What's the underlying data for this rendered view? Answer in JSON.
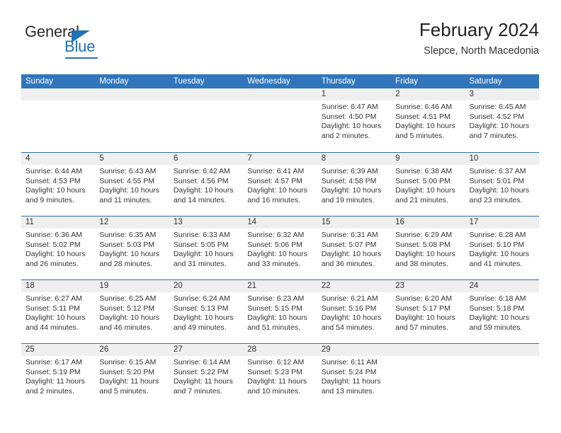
{
  "brand": {
    "name_part1": "General",
    "name_part2": "Blue",
    "triangle_color": "#2171b5"
  },
  "header": {
    "title": "February 2024",
    "subtitle": "Slepce, North Macedonia"
  },
  "theme": {
    "header_blue": "#3176bc",
    "separator_blue": "#2f6fad",
    "datebar_gray": "#efefef"
  },
  "weekdays": [
    "Sunday",
    "Monday",
    "Tuesday",
    "Wednesday",
    "Thursday",
    "Friday",
    "Saturday"
  ],
  "weeks": [
    {
      "days": [
        {
          "num": "",
          "lines": []
        },
        {
          "num": "",
          "lines": []
        },
        {
          "num": "",
          "lines": []
        },
        {
          "num": "",
          "lines": []
        },
        {
          "num": "1",
          "lines": [
            "Sunrise: 6:47 AM",
            "Sunset: 4:50 PM",
            "Daylight: 10 hours",
            "and 2 minutes."
          ]
        },
        {
          "num": "2",
          "lines": [
            "Sunrise: 6:46 AM",
            "Sunset: 4:51 PM",
            "Daylight: 10 hours",
            "and 5 minutes."
          ]
        },
        {
          "num": "3",
          "lines": [
            "Sunrise: 6:45 AM",
            "Sunset: 4:52 PM",
            "Daylight: 10 hours",
            "and 7 minutes."
          ]
        }
      ]
    },
    {
      "days": [
        {
          "num": "4",
          "lines": [
            "Sunrise: 6:44 AM",
            "Sunset: 4:53 PM",
            "Daylight: 10 hours",
            "and 9 minutes."
          ]
        },
        {
          "num": "5",
          "lines": [
            "Sunrise: 6:43 AM",
            "Sunset: 4:55 PM",
            "Daylight: 10 hours",
            "and 11 minutes."
          ]
        },
        {
          "num": "6",
          "lines": [
            "Sunrise: 6:42 AM",
            "Sunset: 4:56 PM",
            "Daylight: 10 hours",
            "and 14 minutes."
          ]
        },
        {
          "num": "7",
          "lines": [
            "Sunrise: 6:41 AM",
            "Sunset: 4:57 PM",
            "Daylight: 10 hours",
            "and 16 minutes."
          ]
        },
        {
          "num": "8",
          "lines": [
            "Sunrise: 6:39 AM",
            "Sunset: 4:58 PM",
            "Daylight: 10 hours",
            "and 19 minutes."
          ]
        },
        {
          "num": "9",
          "lines": [
            "Sunrise: 6:38 AM",
            "Sunset: 5:00 PM",
            "Daylight: 10 hours",
            "and 21 minutes."
          ]
        },
        {
          "num": "10",
          "lines": [
            "Sunrise: 6:37 AM",
            "Sunset: 5:01 PM",
            "Daylight: 10 hours",
            "and 23 minutes."
          ]
        }
      ]
    },
    {
      "days": [
        {
          "num": "11",
          "lines": [
            "Sunrise: 6:36 AM",
            "Sunset: 5:02 PM",
            "Daylight: 10 hours",
            "and 26 minutes."
          ]
        },
        {
          "num": "12",
          "lines": [
            "Sunrise: 6:35 AM",
            "Sunset: 5:03 PM",
            "Daylight: 10 hours",
            "and 28 minutes."
          ]
        },
        {
          "num": "13",
          "lines": [
            "Sunrise: 6:33 AM",
            "Sunset: 5:05 PM",
            "Daylight: 10 hours",
            "and 31 minutes."
          ]
        },
        {
          "num": "14",
          "lines": [
            "Sunrise: 6:32 AM",
            "Sunset: 5:06 PM",
            "Daylight: 10 hours",
            "and 33 minutes."
          ]
        },
        {
          "num": "15",
          "lines": [
            "Sunrise: 6:31 AM",
            "Sunset: 5:07 PM",
            "Daylight: 10 hours",
            "and 36 minutes."
          ]
        },
        {
          "num": "16",
          "lines": [
            "Sunrise: 6:29 AM",
            "Sunset: 5:08 PM",
            "Daylight: 10 hours",
            "and 38 minutes."
          ]
        },
        {
          "num": "17",
          "lines": [
            "Sunrise: 6:28 AM",
            "Sunset: 5:10 PM",
            "Daylight: 10 hours",
            "and 41 minutes."
          ]
        }
      ]
    },
    {
      "days": [
        {
          "num": "18",
          "lines": [
            "Sunrise: 6:27 AM",
            "Sunset: 5:11 PM",
            "Daylight: 10 hours",
            "and 44 minutes."
          ]
        },
        {
          "num": "19",
          "lines": [
            "Sunrise: 6:25 AM",
            "Sunset: 5:12 PM",
            "Daylight: 10 hours",
            "and 46 minutes."
          ]
        },
        {
          "num": "20",
          "lines": [
            "Sunrise: 6:24 AM",
            "Sunset: 5:13 PM",
            "Daylight: 10 hours",
            "and 49 minutes."
          ]
        },
        {
          "num": "21",
          "lines": [
            "Sunrise: 6:23 AM",
            "Sunset: 5:15 PM",
            "Daylight: 10 hours",
            "and 51 minutes."
          ]
        },
        {
          "num": "22",
          "lines": [
            "Sunrise: 6:21 AM",
            "Sunset: 5:16 PM",
            "Daylight: 10 hours",
            "and 54 minutes."
          ]
        },
        {
          "num": "23",
          "lines": [
            "Sunrise: 6:20 AM",
            "Sunset: 5:17 PM",
            "Daylight: 10 hours",
            "and 57 minutes."
          ]
        },
        {
          "num": "24",
          "lines": [
            "Sunrise: 6:18 AM",
            "Sunset: 5:18 PM",
            "Daylight: 10 hours",
            "and 59 minutes."
          ]
        }
      ]
    },
    {
      "days": [
        {
          "num": "25",
          "lines": [
            "Sunrise: 6:17 AM",
            "Sunset: 5:19 PM",
            "Daylight: 11 hours",
            "and 2 minutes."
          ]
        },
        {
          "num": "26",
          "lines": [
            "Sunrise: 6:15 AM",
            "Sunset: 5:20 PM",
            "Daylight: 11 hours",
            "and 5 minutes."
          ]
        },
        {
          "num": "27",
          "lines": [
            "Sunrise: 6:14 AM",
            "Sunset: 5:22 PM",
            "Daylight: 11 hours",
            "and 7 minutes."
          ]
        },
        {
          "num": "28",
          "lines": [
            "Sunrise: 6:12 AM",
            "Sunset: 5:23 PM",
            "Daylight: 11 hours",
            "and 10 minutes."
          ]
        },
        {
          "num": "29",
          "lines": [
            "Sunrise: 6:11 AM",
            "Sunset: 5:24 PM",
            "Daylight: 11 hours",
            "and 13 minutes."
          ]
        },
        {
          "num": "",
          "lines": []
        },
        {
          "num": "",
          "lines": []
        }
      ]
    }
  ]
}
